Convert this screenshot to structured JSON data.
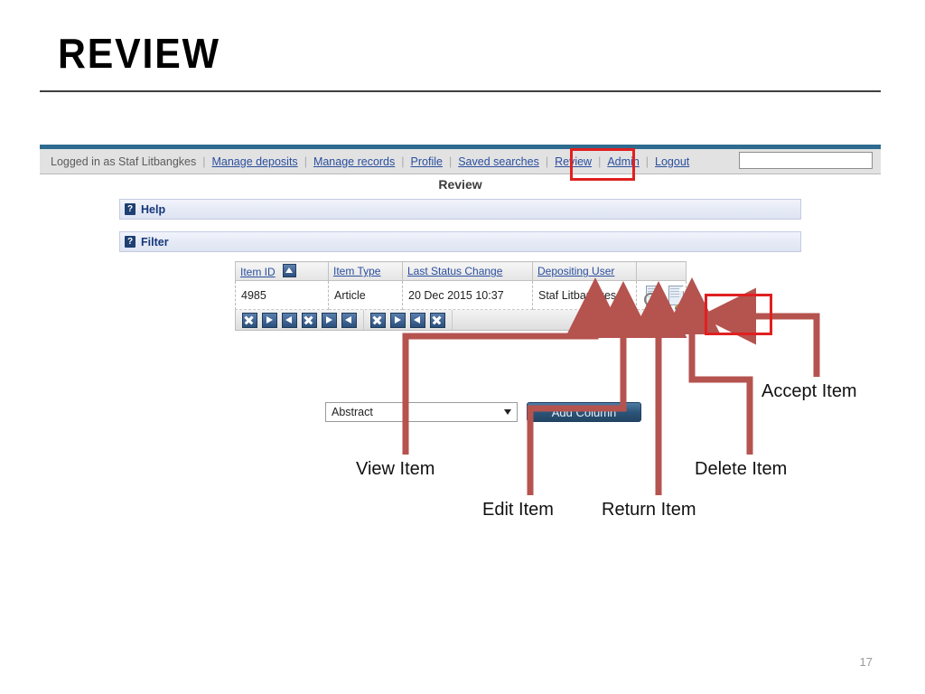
{
  "slide": {
    "title": "REVIEW",
    "page_number": "17"
  },
  "app": {
    "navbar": {
      "logged_in_text": "Logged in as Staf Litbangkes",
      "separator": "|",
      "links": [
        {
          "label": "Manage deposits",
          "name": "nav-manage-deposits"
        },
        {
          "label": "Manage records",
          "name": "nav-manage-records"
        },
        {
          "label": "Profile",
          "name": "nav-profile"
        },
        {
          "label": "Saved searches",
          "name": "nav-saved-searches"
        },
        {
          "label": "Review",
          "name": "nav-review"
        },
        {
          "label": "Admin",
          "name": "nav-admin"
        },
        {
          "label": "Logout",
          "name": "nav-logout"
        }
      ],
      "search_value": "",
      "search_placeholder": ""
    },
    "page_title": "Review",
    "panels": [
      {
        "icon": "question-icon",
        "label": "Help"
      },
      {
        "icon": "question-icon",
        "label": "Filter"
      }
    ],
    "table": {
      "headers": [
        "Item ID",
        "Item Type",
        "Last Status Change",
        "Depositing User",
        ""
      ],
      "sort_column": "Item ID",
      "sort_direction": "ascending",
      "rows": [
        {
          "item_id": "4985",
          "item_type": "Article",
          "last_status_change": "20 Dec 2015 10:37",
          "depositing_user": "Staf Litbangkes",
          "actions": [
            {
              "name": "view-item-icon",
              "title": "View Item"
            },
            {
              "name": "edit-item-icon",
              "title": "Edit Item"
            },
            {
              "name": "return-item-icon",
              "title": "Return Item"
            },
            {
              "name": "delete-item-icon",
              "title": "Delete Item"
            },
            {
              "name": "accept-item-icon",
              "title": "Accept Item"
            }
          ]
        }
      ]
    },
    "pager": {
      "groups": [
        [
          "x",
          "right",
          "left",
          "x",
          "right",
          "left"
        ],
        [
          "x",
          "right",
          "left",
          "x"
        ],
        []
      ]
    },
    "column_chooser": {
      "selected": "Abstract",
      "options": [
        "Abstract"
      ],
      "button_label": "Add Column"
    }
  },
  "annotations": {
    "accent_color": "#b5534f",
    "highlight_color": "#e02020",
    "callouts": [
      {
        "label": "View Item",
        "name": "callout-view-item"
      },
      {
        "label": "Edit Item",
        "name": "callout-edit-item"
      },
      {
        "label": "Return Item",
        "name": "callout-return-item"
      },
      {
        "label": "Delete Item",
        "name": "callout-delete-item"
      },
      {
        "label": "Accept Item",
        "name": "callout-accept-item"
      }
    ]
  }
}
